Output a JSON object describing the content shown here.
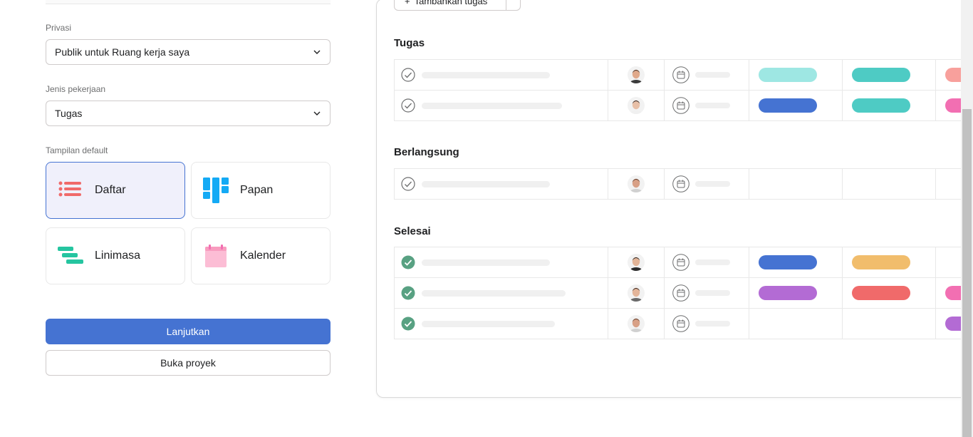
{
  "form": {
    "privacy": {
      "label": "Privasi",
      "value": "Publik untuk Ruang kerja saya"
    },
    "work_type": {
      "label": "Jenis pekerjaan",
      "value": "Tugas"
    },
    "default_view": {
      "label": "Tampilan default",
      "options": [
        {
          "label": "Daftar",
          "icon": "list-icon",
          "selected": true
        },
        {
          "label": "Papan",
          "icon": "board-icon",
          "selected": false
        },
        {
          "label": "Linimasa",
          "icon": "timeline-icon",
          "selected": false
        },
        {
          "label": "Kalender",
          "icon": "calendar-icon",
          "selected": false
        }
      ]
    },
    "continue_label": "Lanjutkan",
    "open_project_label": "Buka proyek"
  },
  "preview": {
    "add_task_label": "Tambahkan tugas",
    "sections": [
      {
        "title": "Tugas",
        "rows": [
          {
            "done": false,
            "avatar": "man-1",
            "tags": [
              "#9ee7e3",
              "#4ecbc4",
              "#f8a09c"
            ]
          },
          {
            "done": false,
            "avatar": "woman-1",
            "tags": [
              "#4573d2",
              "#4ecbc4",
              "#f26fb2"
            ]
          }
        ]
      },
      {
        "title": "Berlangsung",
        "rows": [
          {
            "done": false,
            "avatar": "man-2",
            "tags": []
          }
        ]
      },
      {
        "title": "Selesai",
        "rows": [
          {
            "done": true,
            "avatar": "man-3",
            "tags": [
              "#4573d2",
              "#f1bd6c",
              ""
            ]
          },
          {
            "done": true,
            "avatar": "woman-2",
            "tags": [
              "#b36bd4",
              "#f06a6a",
              "#f26fb2"
            ]
          },
          {
            "done": true,
            "avatar": "man-2",
            "tags": [
              "",
              "",
              "#b36bd4"
            ]
          }
        ]
      }
    ]
  },
  "colors": {
    "accent": "#4573d2",
    "done_green": "#58a182",
    "list_icon": "#f06a6a",
    "board_icon": "#14aaf5",
    "timeline_icon": "#25c5a0",
    "calendar_icon": "#fcbdd5"
  }
}
